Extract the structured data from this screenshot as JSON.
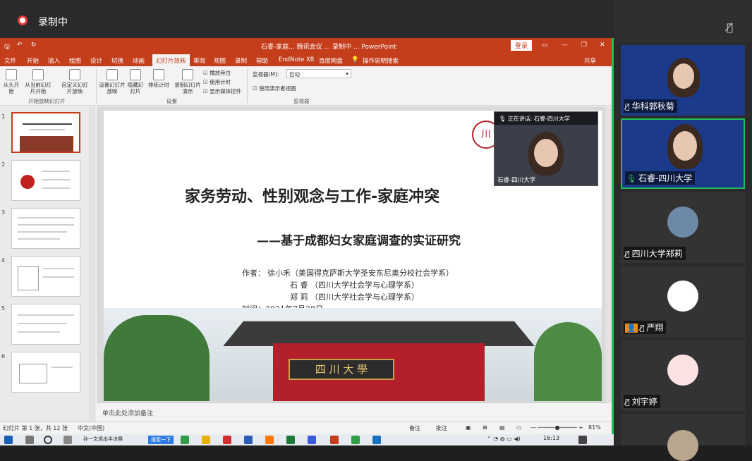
{
  "recording": {
    "label": "录制中"
  },
  "ppt": {
    "title": "石睿-家庭... 腾讯会议 ... 录制中 ... PowerPoint",
    "login": "登录",
    "menu": [
      "文件",
      "开始",
      "插入",
      "绘图",
      "设计",
      "切换",
      "动画",
      "幻灯片放映",
      "审阅",
      "视图",
      "录制",
      "帮助",
      "EndNote X8",
      "百度网盘",
      "操作说明搜索"
    ],
    "share": "共享",
    "ribbon": {
      "from_start": "从头开始",
      "from_current": "从当前幻灯片开始",
      "custom": "自定义幻灯片放映",
      "group1": "开始放映幻灯片",
      "setup": "设置幻灯片放映",
      "hide": "隐藏幻灯片",
      "rehearse": "排练计时",
      "record": "录制幻灯片演示",
      "chk_narration": "播放旁白",
      "chk_timing": "使用计时",
      "chk_media": "显示媒体控件",
      "group2": "设置",
      "monitor_label": "监视器(M):",
      "monitor_value": "自动",
      "presenter_view": "使用演示者视图",
      "group3": "监视器"
    },
    "slide_numbers": [
      "1",
      "2",
      "3",
      "4",
      "5",
      "6"
    ],
    "slide": {
      "title": "家务劳动、性别观念与工作-家庭冲突",
      "subtitle": "——基于成都妇女家庭调查的实证研究",
      "author_label": "作者：",
      "author1": "徐小禾（美国得克萨斯大学圣安东尼奥分校社会学系）",
      "author2": "石    睿 （四川大学社会学与心理学系）",
      "author3": "郑    莉 （四川大学社会学与心理学系）",
      "date": "时间：2021年7月28日",
      "plaque": "四 川 大 學"
    },
    "speaker": {
      "top": "正在讲话: 石睿-四川大学",
      "name": "石睿-四川大学"
    },
    "notes": "单击此处添加备注",
    "status": {
      "slide_info": "幻灯片 第 1 张，共 12 张",
      "lang": "中文(中国)",
      "notes_btn": "备注",
      "comments_btn": "批注",
      "zoom": "81%"
    }
  },
  "taskbar": {
    "search": "搜索一下",
    "app": "孙一文退出半决赛",
    "time": "16:13"
  },
  "participants": [
    {
      "name": "华科郭秋菊",
      "type": "video"
    },
    {
      "name": "石睿-四川大学",
      "type": "video",
      "active": true
    },
    {
      "name": "四川大学郑莉",
      "type": "avatar"
    },
    {
      "name": "严翔",
      "type": "avatar"
    },
    {
      "name": "刘宇婷",
      "type": "avatar"
    }
  ],
  "colors": {
    "ppt_accent": "#c43e1c",
    "active_border": "#1fbf5a",
    "recording": "#e53935"
  }
}
